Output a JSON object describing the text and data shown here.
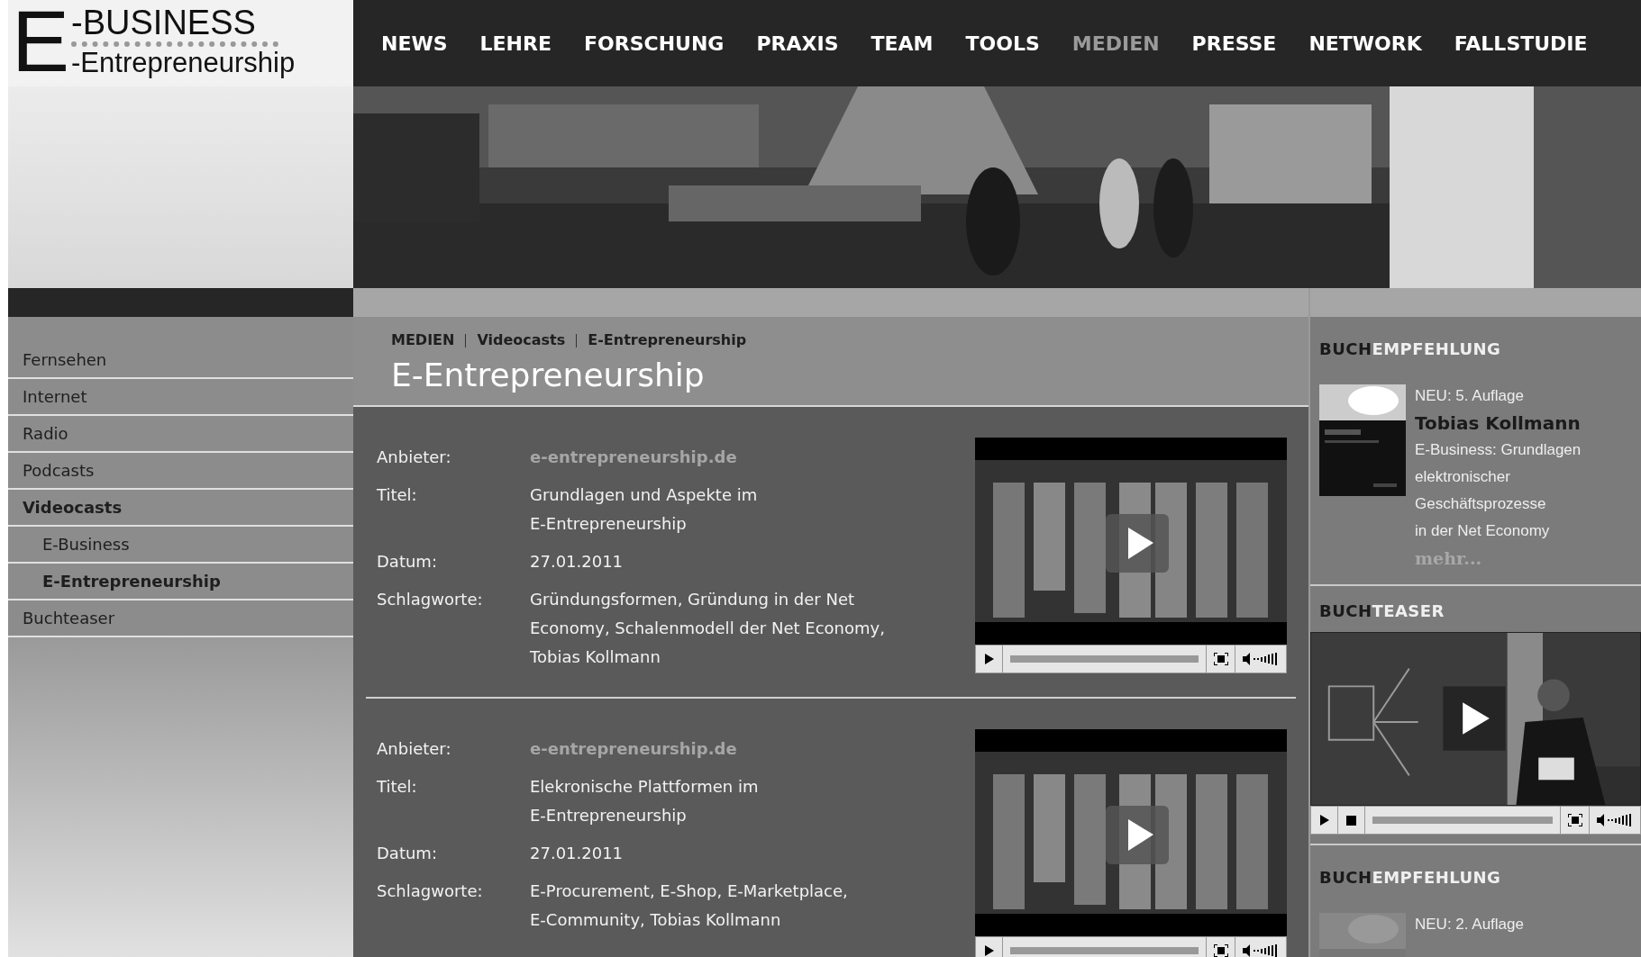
{
  "logo": {
    "letter": "E",
    "line1": "-BUSINESS",
    "line2": "-Entrepreneurship"
  },
  "nav": [
    {
      "label": "NEWS",
      "selected": false
    },
    {
      "label": "LEHRE",
      "selected": false
    },
    {
      "label": "FORSCHUNG",
      "selected": false
    },
    {
      "label": "PRAXIS",
      "selected": false
    },
    {
      "label": "TEAM",
      "selected": false
    },
    {
      "label": "TOOLS",
      "selected": false
    },
    {
      "label": "MEDIEN",
      "selected": true
    },
    {
      "label": "PRESSE",
      "selected": false
    },
    {
      "label": "NETWORK",
      "selected": false
    },
    {
      "label": "FALLSTUDIE",
      "selected": false
    }
  ],
  "sidebar": {
    "items": [
      {
        "label": "Fernsehen",
        "selected": false
      },
      {
        "label": "Internet",
        "selected": false
      },
      {
        "label": "Radio",
        "selected": false
      },
      {
        "label": "Podcasts",
        "selected": false
      },
      {
        "label": "Videocasts",
        "selected": true,
        "children": [
          {
            "label": "E-Business",
            "selected": false
          },
          {
            "label": "E-Entrepreneurship",
            "selected": true
          }
        ]
      },
      {
        "label": "Buchteaser",
        "selected": false
      }
    ]
  },
  "breadcrumb": [
    "MEDIEN",
    "Videocasts",
    "E-Entrepreneurship"
  ],
  "page_title": "E-Entrepreneurship",
  "entries": [
    {
      "fields": [
        {
          "label": "Anbieter:",
          "kind": "link",
          "lines": [
            "e-entrepreneurship.de"
          ]
        },
        {
          "label": "Titel:",
          "kind": "text",
          "lines": [
            "Grundlagen und Aspekte im",
            "E-Entrepreneurship"
          ]
        },
        {
          "label": "Datum:",
          "kind": "text",
          "lines": [
            "27.01.2011"
          ]
        },
        {
          "label": "Schlagworte:",
          "kind": "text",
          "lines": [
            "Gründungsformen, Gründung in der Net",
            "Economy, Schalenmodell der Net Economy,",
            "Tobias Kollmann"
          ]
        }
      ]
    },
    {
      "fields": [
        {
          "label": "Anbieter:",
          "kind": "link",
          "lines": [
            "e-entrepreneurship.de"
          ]
        },
        {
          "label": "Titel:",
          "kind": "text",
          "lines": [
            "Elekronische Plattformen im",
            "E-Entrepreneurship"
          ]
        },
        {
          "label": "Datum:",
          "kind": "text",
          "lines": [
            "27.01.2011"
          ]
        },
        {
          "label": "Schlagworte:",
          "kind": "text",
          "lines": [
            "E-Procurement, E-Shop, E-Marketplace,",
            "E-Community, Tobias Kollmann"
          ]
        }
      ]
    }
  ],
  "right": [
    {
      "kind": "book",
      "heading_prefix": "BUCH",
      "heading_rest": "EMPFEHLUNG",
      "badge": "NEU: 5. Auflage",
      "author": "Tobias Kollmann",
      "title_lines": [
        "E-Business: Grundlagen",
        "elektronischer",
        "Geschäftsprozesse",
        "in der Net Economy"
      ],
      "more": "mehr..."
    },
    {
      "kind": "video",
      "heading_prefix": "BUCH",
      "heading_rest": "TEASER"
    },
    {
      "kind": "book",
      "heading_prefix": "BUCH",
      "heading_rest": "EMPFEHLUNG",
      "badge": "NEU: 2. Auflage"
    }
  ]
}
